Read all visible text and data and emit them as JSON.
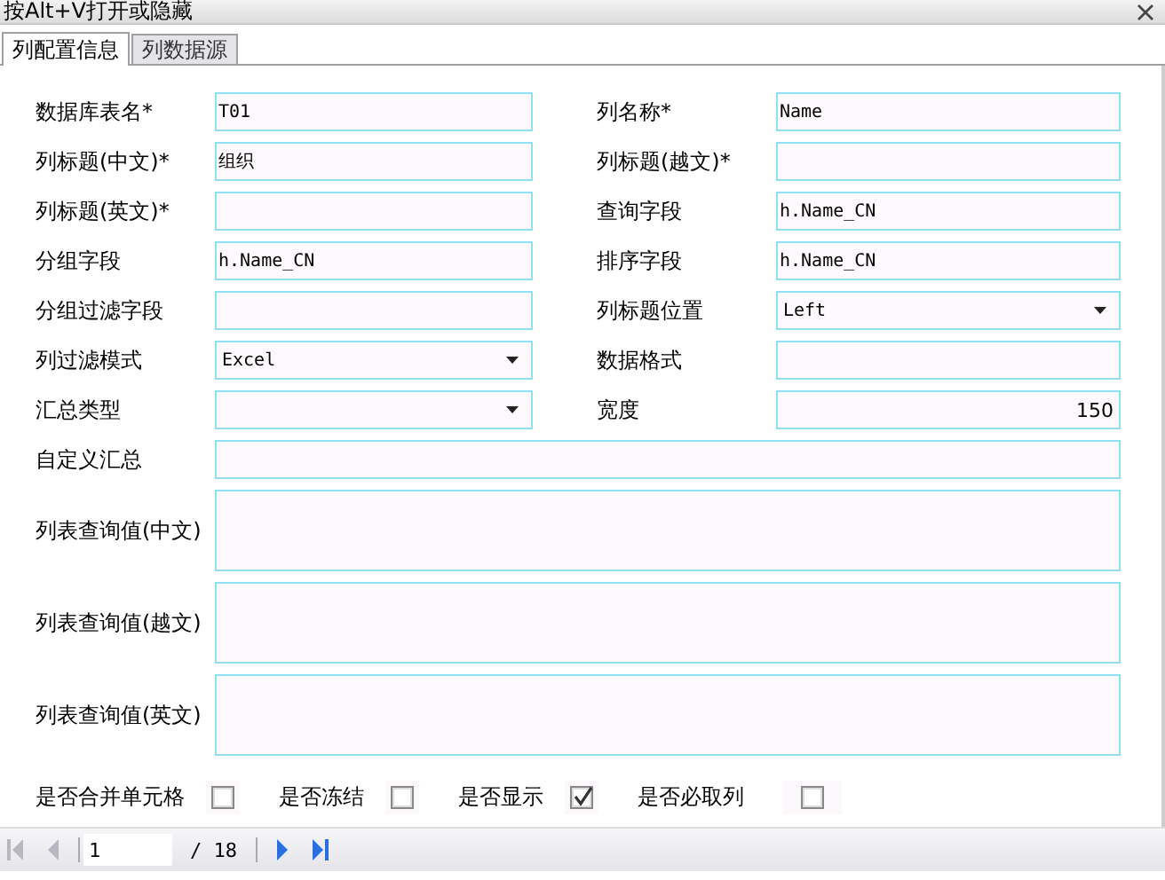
{
  "window": {
    "title": "按Alt+V打开或隐藏"
  },
  "tabs": [
    {
      "label": "列配置信息",
      "selected": true
    },
    {
      "label": "列数据源",
      "selected": false
    }
  ],
  "form_rows": [
    [
      {
        "label": "数据库表名*",
        "value": "T01",
        "kind": "text"
      },
      {
        "label": "列名称*",
        "value": "Name",
        "kind": "text"
      }
    ],
    [
      {
        "label": "列标题(中文)*",
        "value": "组织",
        "kind": "text"
      },
      {
        "label": "列标题(越文)*",
        "kind": "text"
      }
    ],
    [
      {
        "label": "列标题(英文)*",
        "kind": "text"
      },
      {
        "label": "查询字段",
        "value": "h.Name_CN",
        "kind": "text"
      }
    ],
    [
      {
        "label": "分组字段",
        "value": "h.Name_CN",
        "kind": "text"
      },
      {
        "label": "排序字段",
        "value": "h.Name_CN",
        "kind": "text"
      }
    ],
    [
      {
        "label": "分组过滤字段",
        "kind": "text"
      },
      {
        "label": "列标题位置",
        "value": "Left",
        "kind": "select"
      }
    ],
    [
      {
        "label": "列过滤模式",
        "value": "Excel",
        "kind": "select"
      },
      {
        "label": "数据格式",
        "kind": "text"
      }
    ],
    [
      {
        "label": "汇总类型",
        "kind": "select"
      },
      {
        "label": "宽度",
        "value": "150",
        "kind": "number"
      }
    ],
    [
      {
        "label": "自定义汇总",
        "kind": "text"
      }
    ],
    [
      {
        "label": "列表查询值(中文)",
        "kind": "textarea"
      }
    ],
    [
      {
        "label": "列表查询值(越文)",
        "kind": "textarea"
      }
    ],
    [
      {
        "label": "列表查询值(英文)",
        "kind": "textarea"
      }
    ]
  ],
  "checkboxes": [
    {
      "label": "是否合并单元格",
      "checked": false
    },
    {
      "label": "是否冻结",
      "checked": false
    },
    {
      "label": "是否显示",
      "checked": true
    },
    {
      "label": "是否必取列",
      "checked": false
    }
  ],
  "pager": {
    "page": "1",
    "total": "/ 18",
    "buttons": [
      {
        "kind": "first",
        "disabled": true
      },
      {
        "kind": "prev",
        "disabled": true
      },
      {
        "kind": "next",
        "disabled": false
      },
      {
        "kind": "last",
        "disabled": false
      }
    ]
  }
}
